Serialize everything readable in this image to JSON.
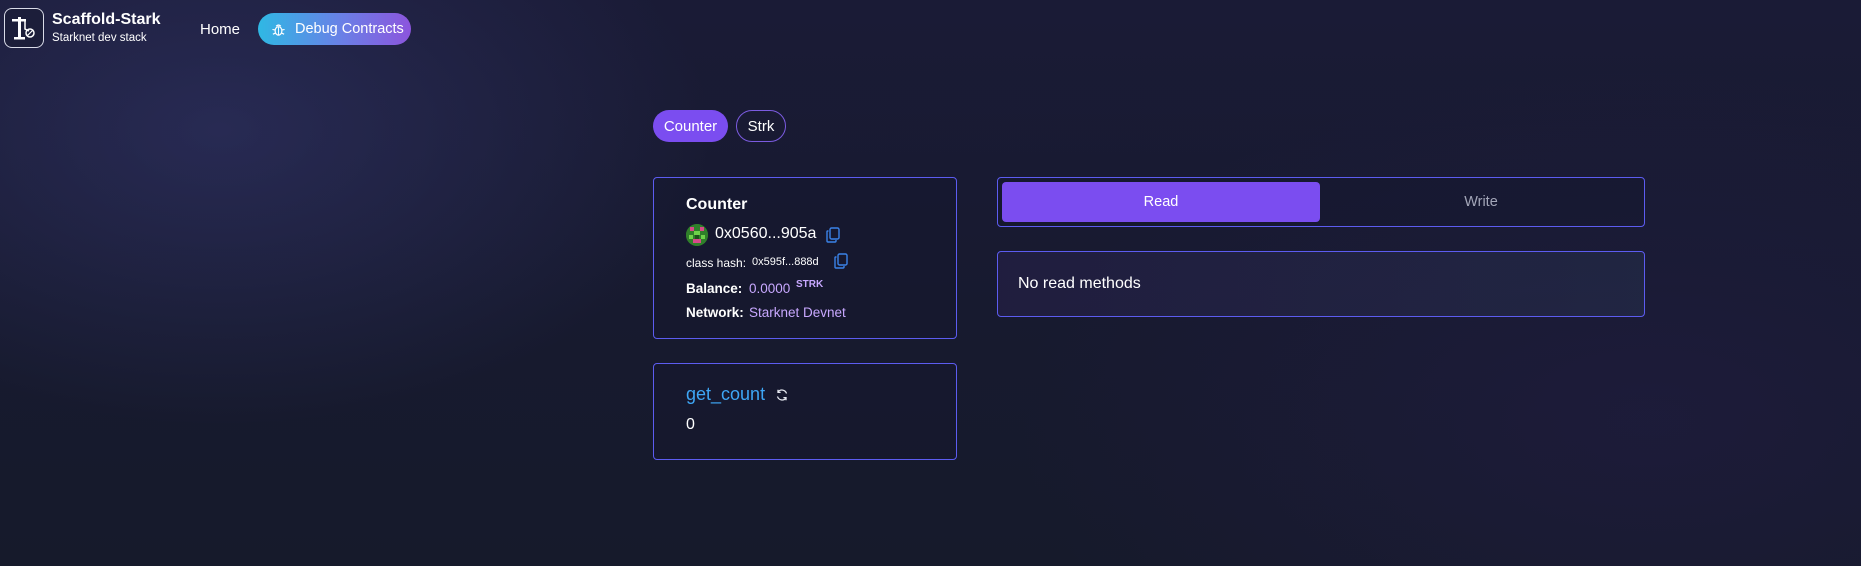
{
  "header": {
    "brand_title": "Scaffold-Stark",
    "brand_subtitle": "Starknet dev stack",
    "nav_home": "Home",
    "nav_debug": "Debug Contracts"
  },
  "contract_tabs": [
    {
      "label": "Counter",
      "active": true
    },
    {
      "label": "Strk",
      "active": false
    }
  ],
  "contract_info": {
    "name": "Counter",
    "address": "0x0560...905a",
    "class_hash_label": "class hash:",
    "class_hash": "0x595f...888d",
    "balance_label": "Balance:",
    "balance_value": "0.0000",
    "balance_unit": "STRK",
    "network_label": "Network:",
    "network_value": "Starknet Devnet"
  },
  "variables": [
    {
      "name": "get_count",
      "value": "0"
    }
  ],
  "method_tabs": {
    "read": "Read",
    "write": "Write",
    "active": "read"
  },
  "methods_panel": {
    "empty_text": "No read methods"
  },
  "colors": {
    "accent_purple": "#7b4df0",
    "border_blue": "#5c5cf0",
    "link_blue": "#3ea6f5",
    "value_lilac": "#c8a8ff"
  }
}
